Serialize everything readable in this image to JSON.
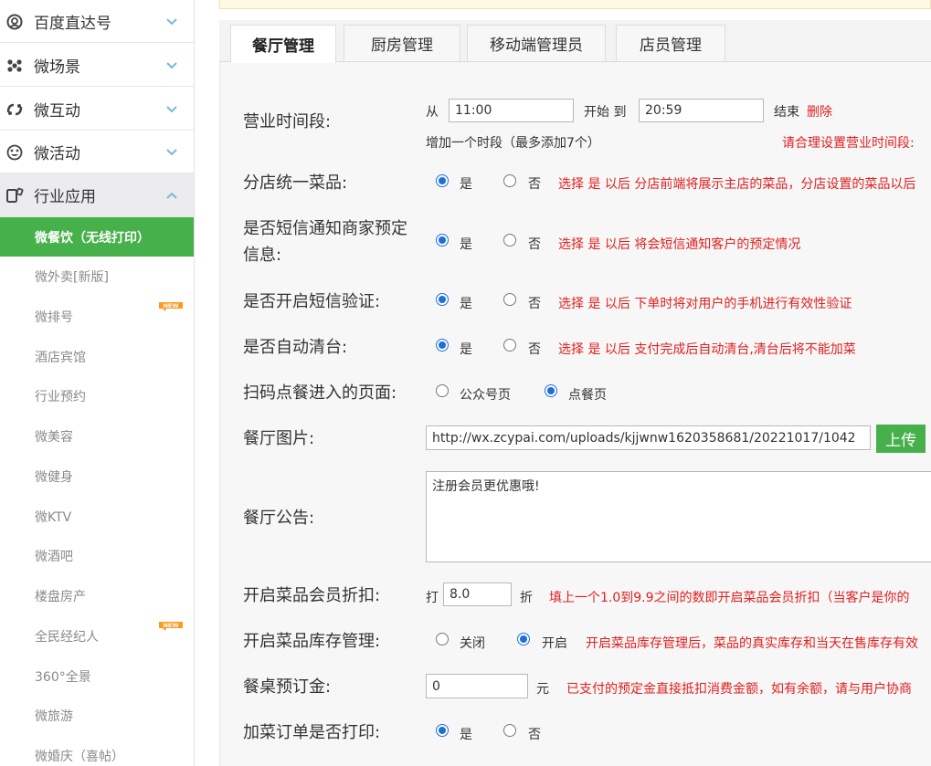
{
  "sidebar": {
    "groups": [
      {
        "label": "百度直达号",
        "icon": "at-sign-icon"
      },
      {
        "label": "微场景",
        "icon": "scene-dots-icon"
      },
      {
        "label": "微互动",
        "icon": "interact-icon"
      },
      {
        "label": "微活动",
        "icon": "activity-icon"
      },
      {
        "label": "行业应用",
        "icon": "industry-app-icon"
      }
    ],
    "subitems": [
      {
        "label": "微餐饮（无线打印）"
      },
      {
        "label": "微外卖[新版]"
      },
      {
        "label": "微排号",
        "badge": "NEW"
      },
      {
        "label": "酒店宾馆"
      },
      {
        "label": "行业预约"
      },
      {
        "label": "微美容"
      },
      {
        "label": "微健身"
      },
      {
        "label": "微KTV"
      },
      {
        "label": "微酒吧"
      },
      {
        "label": "楼盘房产"
      },
      {
        "label": "全民经纪人",
        "badge": "NEW"
      },
      {
        "label": "360°全景"
      },
      {
        "label": "微旅游"
      },
      {
        "label": "微婚庆（喜帖）"
      }
    ],
    "colors": {
      "active": "#46b04a",
      "expanded": "#ececef"
    }
  },
  "tabs": [
    {
      "label": "餐厅管理",
      "active": true
    },
    {
      "label": "厨房管理"
    },
    {
      "label": "移动端管理员"
    },
    {
      "label": "店员管理"
    }
  ],
  "form": {
    "hours": {
      "label": "营业时间段:",
      "from": "从",
      "start_value": "11:00",
      "start_to": "开始 到",
      "end_value": "20:59",
      "end": "结束",
      "delete": "删除",
      "add_period": "增加一个时段（最多添加7个）",
      "hint": "请合理设置营业时间段:"
    },
    "unified_menu": {
      "label": "分店统一菜品:",
      "yes": "是",
      "no": "否",
      "hint": "选择 是 以后 分店前端将展示主店的菜品，分店设置的菜品以后"
    },
    "sms_notify": {
      "label1": "是否短信通知商家预定",
      "label2": "信息:",
      "yes": "是",
      "no": "否",
      "hint": "选择 是 以后 将会短信通知客户的预定情况"
    },
    "sms_verify": {
      "label": "是否开启短信验证:",
      "yes": "是",
      "no": "否",
      "hint": "选择 是 以后 下单时将对用户的手机进行有效性验证"
    },
    "auto_clear": {
      "label": "是否自动清台:",
      "yes": "是",
      "no": "否",
      "hint": "选择 是 以后 支付完成后自动清台,清台后将不能加菜"
    },
    "scan_page": {
      "label": "扫码点餐进入的页面:",
      "opt1": "公众号页",
      "opt2": "点餐页"
    },
    "image": {
      "label": "餐厅图片:",
      "value": "http://wx.zcypai.com/uploads/kjjwnw1620358681/20221017/1042",
      "upload": "上传"
    },
    "notice": {
      "label": "餐厅公告:",
      "value": "注册会员更优惠哦!"
    },
    "discount": {
      "label": "开启菜品会员折扣:",
      "prefix": "打",
      "value": "8.0",
      "suffix": "折",
      "hint": "填上一个1.0到9.9之间的数即开启菜品会员折扣（当客户是你的"
    },
    "stock": {
      "label": "开启菜品库存管理:",
      "off": "关闭",
      "on": "开启",
      "hint": "开启菜品库存管理后，菜品的真实库存和当天在售库存有效"
    },
    "deposit": {
      "label": "餐桌预订金:",
      "value": "0",
      "unit": "元",
      "hint": "已支付的预定金直接抵扣消费金额，如有余额，请与用户协商"
    },
    "addon_print": {
      "label": "加菜订单是否打印:",
      "yes": "是",
      "no": "否"
    }
  },
  "colors": {
    "hint_red": "#e02020",
    "radio_blue": "#1e6fd9",
    "upload_green": "#46b04a"
  }
}
